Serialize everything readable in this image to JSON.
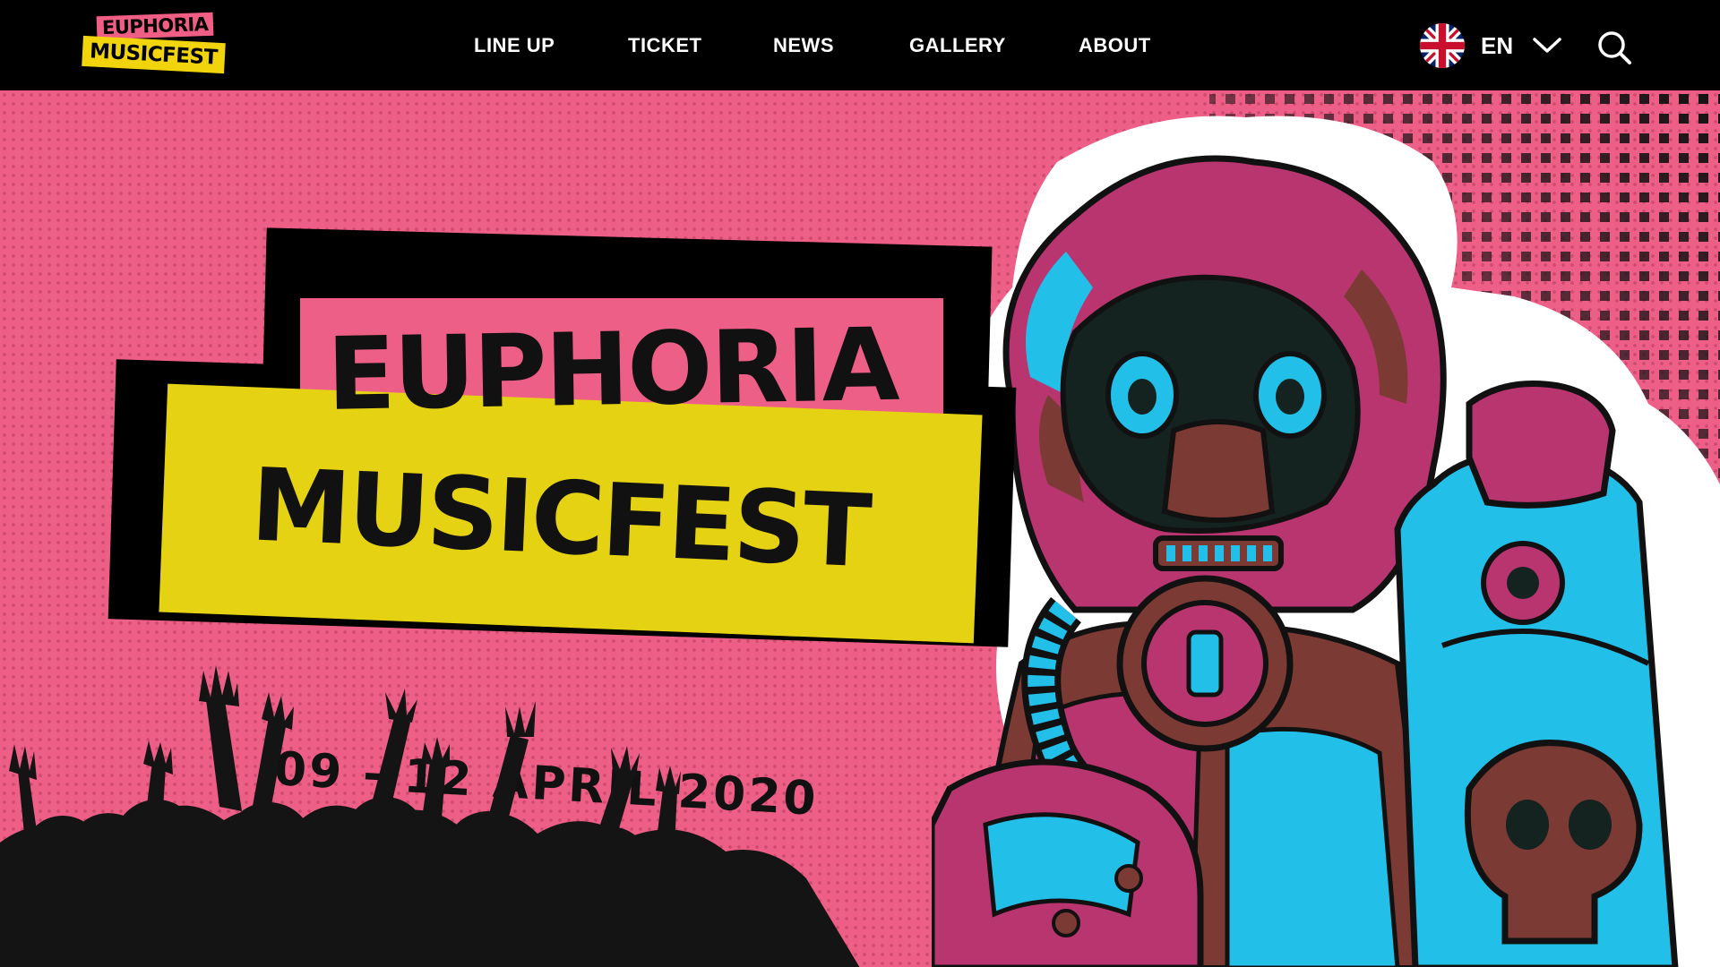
{
  "header": {
    "logo": {
      "line1": "EUPHORIA",
      "line2": "MUSICFEST"
    },
    "nav": [
      {
        "label": "LINE UP"
      },
      {
        "label": "TICKET"
      },
      {
        "label": "NEWS"
      },
      {
        "label": "GALLERY"
      },
      {
        "label": "ABOUT"
      }
    ],
    "language": {
      "label": "EN",
      "flag_icon": "uk-flag-icon",
      "chevron_icon": "chevron-down-icon"
    },
    "search_icon": "search-icon"
  },
  "hero": {
    "title_line1": "EUPHORIA",
    "title_line2": "MUSICFEST",
    "date": "09 - 12 APRIL 2020"
  },
  "colors": {
    "background": "#ee5f87",
    "nav_background": "#000000",
    "accent_yellow": "#e5d212",
    "accent_cyan": "#22bfe8",
    "accent_magenta": "#b8356f",
    "accent_brown": "#7b3a33",
    "ink": "#111111"
  }
}
